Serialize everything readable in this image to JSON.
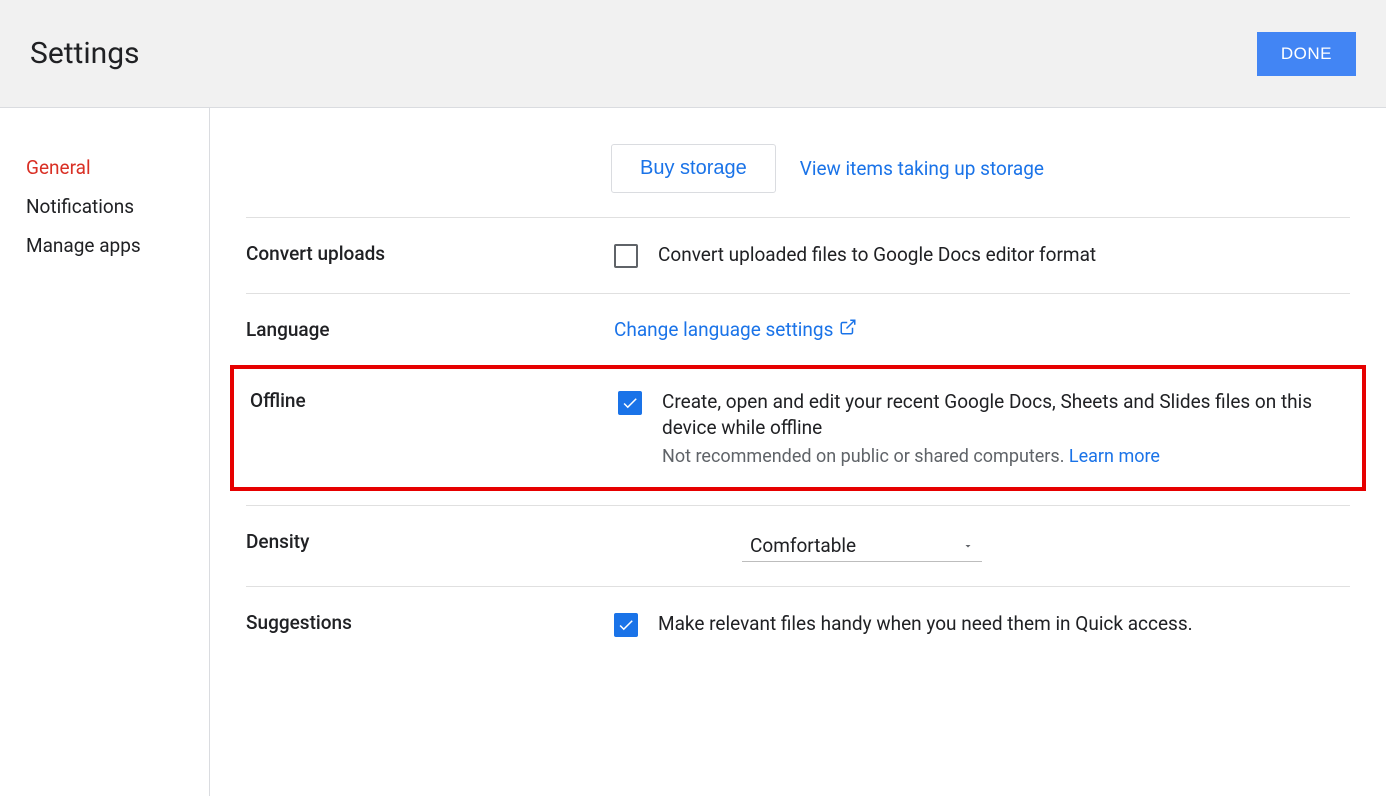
{
  "header": {
    "title": "Settings",
    "done_label": "DONE"
  },
  "sidebar": {
    "items": [
      {
        "label": "General",
        "active": true
      },
      {
        "label": "Notifications",
        "active": false
      },
      {
        "label": "Manage apps",
        "active": false
      }
    ]
  },
  "storage": {
    "buy_label": "Buy storage",
    "view_label": "View items taking up storage"
  },
  "convert": {
    "title": "Convert uploads",
    "checkbox_label": "Convert uploaded files to Google Docs editor format",
    "checked": false
  },
  "language": {
    "title": "Language",
    "link": "Change language settings"
  },
  "offline": {
    "title": "Offline",
    "checkbox_label": "Create, open and edit your recent Google Docs, Sheets and Slides files on this device while offline",
    "subtext": "Not recommended on public or shared computers. ",
    "learn_more": "Learn more",
    "checked": true
  },
  "density": {
    "title": "Density",
    "value": "Comfortable"
  },
  "suggestions": {
    "title": "Suggestions",
    "checkbox_label": "Make relevant files handy when you need them in Quick access.",
    "checked": true
  }
}
